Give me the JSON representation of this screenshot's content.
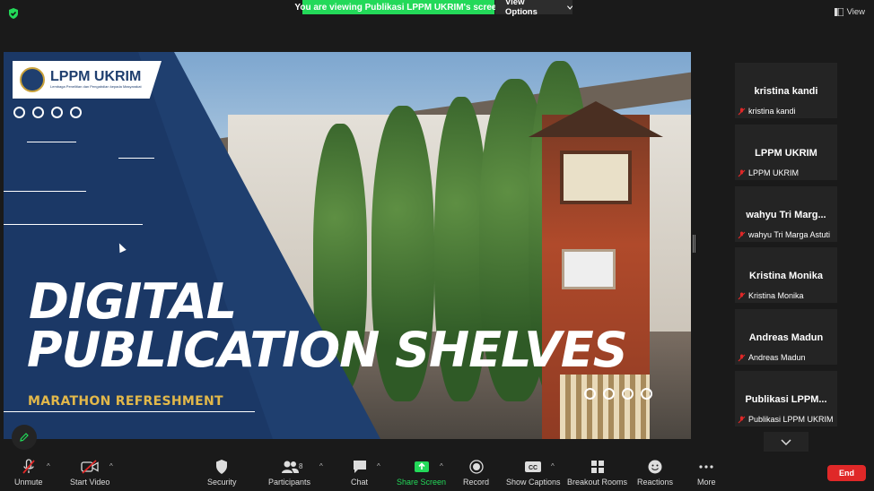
{
  "banner": {
    "text": "You are viewing Publikasi LPPM UKRIM's screen"
  },
  "view_options": {
    "label": "View Options"
  },
  "top_view": {
    "label": "View"
  },
  "slide": {
    "logo_title": "LPPM UKRIM",
    "logo_subtitle": "Lembaga Penelitian dan Pengabdian kepada Masyarakat",
    "title_line1": "DIGITAL",
    "title_line2": "PUBLICATION SHELVES",
    "subtitle": "MARATHON REFRESHMENT"
  },
  "participants": [
    {
      "display": "kristina kandi",
      "label": "kristina kandi"
    },
    {
      "display": "LPPM UKRIM",
      "label": "LPPM UKRIM"
    },
    {
      "display": "wahyu  Tri  Marg...",
      "label": "wahyu Tri Marga Astuti"
    },
    {
      "display": "Kristina Monika",
      "label": "Kristina Monika"
    },
    {
      "display": "Andreas Madun",
      "label": "Andreas Madun"
    },
    {
      "display": "Publikasi  LPPM...",
      "label": "Publikasi LPPM UKRIM"
    }
  ],
  "toolbar": {
    "unmute": "Unmute",
    "start_video": "Start Video",
    "security": "Security",
    "participants": "Participants",
    "participants_count": "8",
    "chat": "Chat",
    "share_screen": "Share Screen",
    "record": "Record",
    "show_captions": "Show Captions",
    "breakout_rooms": "Breakout Rooms",
    "reactions": "Reactions",
    "more": "More",
    "end": "End"
  },
  "colors": {
    "banner_green": "#23d959",
    "end_red": "#e02828",
    "slide_blue": "#1f3f6f",
    "subtitle_gold": "#e2b84a"
  }
}
